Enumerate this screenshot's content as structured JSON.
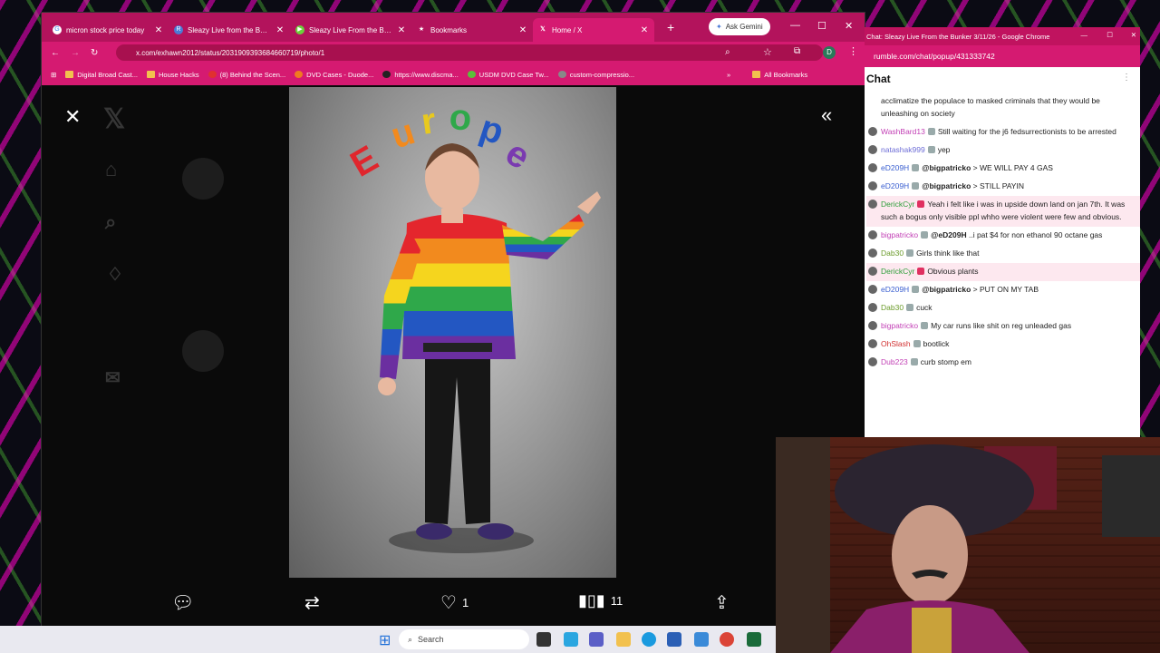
{
  "browser": {
    "tabs": [
      {
        "label": "micron stock price today",
        "icon": "google-icon",
        "color": "#ffffff"
      },
      {
        "label": "Sleazy Live from the Bunker",
        "icon": "rumble-icon",
        "color": "#4a7bd6"
      },
      {
        "label": "Sleazy Live From the Bunker",
        "icon": "rumble-play-icon",
        "color": "#6bd13a"
      },
      {
        "label": "Bookmarks",
        "icon": "star-icon",
        "color": "#ffffff"
      },
      {
        "label": "Home / X",
        "icon": "x-icon",
        "color": "#000000"
      }
    ],
    "ask_gemini": "Ask Gemini",
    "url": "x.com/exhawn2012/status/2031909393684660719/photo/1",
    "bookmarks": [
      {
        "label": "Digital Broad Cast...",
        "icon": "folder-icon"
      },
      {
        "label": "House Hacks",
        "icon": "folder-icon"
      },
      {
        "label": "(8) Behind the Scen...",
        "icon": "favicon"
      },
      {
        "label": "DVD Cases - Duode...",
        "icon": "favicon"
      },
      {
        "label": "https://www.discma...",
        "icon": "favicon"
      },
      {
        "label": "USDM DVD Case Tw...",
        "icon": "favicon"
      },
      {
        "label": "custom-compressio...",
        "icon": "favicon"
      }
    ],
    "all_bookmarks": "All Bookmarks",
    "profile_initial": "D"
  },
  "viewer": {
    "photo_caption_text": "Europe",
    "actions": {
      "likes": "1",
      "views": "11"
    }
  },
  "taskbar": {
    "search_placeholder": "Search"
  },
  "chat_window": {
    "title": "Chat: Sleazy Live From the Bunker 3/11/26 - Google Chrome",
    "url": "rumble.com/chat/popup/431333742",
    "heading": "Chat",
    "messages": [
      {
        "user": "",
        "text": "acclimatize the populace to masked criminals that they would be unleashing on society",
        "color": "#222222",
        "highlight": false
      },
      {
        "user": "WashBard13",
        "text": "Still waiting for the j6 fedsurrectionists to be arrested",
        "color": "#c23fb5",
        "highlight": false
      },
      {
        "user": "natashak999",
        "text": "yep",
        "color": "#6b6bd6",
        "highlight": false
      },
      {
        "user": "eD209H",
        "mention": "@bigpatricko",
        "text": "> WE WILL PAY 4 GAS",
        "color": "#3a5fd0",
        "highlight": false
      },
      {
        "user": "eD209H",
        "mention": "@bigpatricko",
        "text": "> STILL PAYIN",
        "color": "#3a5fd0",
        "highlight": false
      },
      {
        "user": "DerickCyr",
        "text": "Yeah i felt like i was in upside down land on jan 7th. It was such a bogus only visible ppl whho were violent were few and obvious.",
        "color": "#2e9e3a",
        "highlight": true
      },
      {
        "user": "bigpatricko",
        "mention": "@eD209H",
        "text": "..i pat $4 for non ethanol 90 octane gas",
        "color": "#c23fb5",
        "highlight": false
      },
      {
        "user": "Dab30",
        "text": "Girls think like that",
        "color": "#6b9b2a",
        "highlight": false
      },
      {
        "user": "DerickCyr",
        "text": "Obvious plants",
        "color": "#2e9e3a",
        "highlight": true
      },
      {
        "user": "eD209H",
        "mention": "@bigpatricko",
        "text": "> PUT ON MY TAB",
        "color": "#3a5fd0",
        "highlight": false
      },
      {
        "user": "Dab30",
        "text": "cuck",
        "color": "#6b9b2a",
        "highlight": false
      },
      {
        "user": "bigpatricko",
        "text": "My car runs like shit on reg unleaded gas",
        "color": "#c23fb5",
        "highlight": false
      },
      {
        "user": "OhSlash",
        "text": "bootlick",
        "color": "#d23030",
        "highlight": false
      },
      {
        "user": "Dub223",
        "text": "curb stomp em",
        "color": "#c23fb5",
        "highlight": false
      }
    ]
  }
}
